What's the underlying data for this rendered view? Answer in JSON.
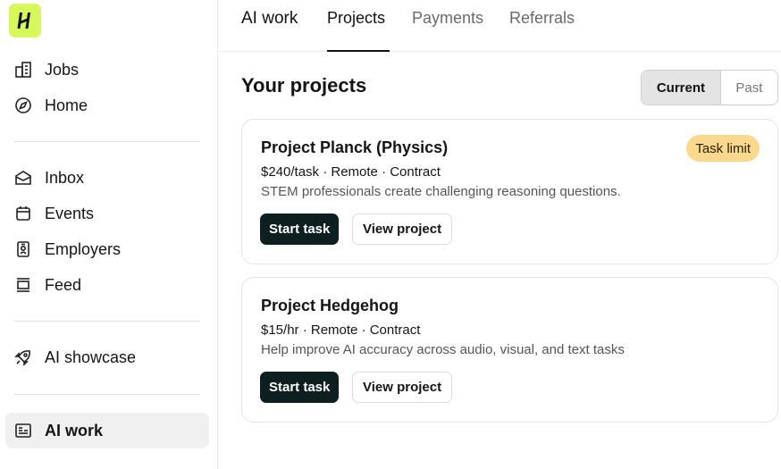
{
  "sidebar": {
    "logo_icon": "handshake-h-logo",
    "items": [
      {
        "label": "Jobs",
        "icon": "building-icon"
      },
      {
        "label": "Home",
        "icon": "compass-icon"
      },
      {
        "label": "Inbox",
        "icon": "inbox-icon"
      },
      {
        "label": "Events",
        "icon": "calendar-icon"
      },
      {
        "label": "Employers",
        "icon": "id-badge-icon"
      },
      {
        "label": "Feed",
        "icon": "feed-icon"
      },
      {
        "label": "AI showcase",
        "icon": "rocket-icon"
      },
      {
        "label": "AI work",
        "icon": "ai-work-icon",
        "active": true
      }
    ]
  },
  "tabs": [
    {
      "label": "AI work"
    },
    {
      "label": "Projects",
      "active": true
    },
    {
      "label": "Payments"
    },
    {
      "label": "Referrals"
    }
  ],
  "main": {
    "title": "Your projects",
    "segment": {
      "current": "Current",
      "past": "Past",
      "selected": "Current"
    },
    "projects": [
      {
        "title": "Project Planck (Physics)",
        "meta": "$240/task · Remote · Contract",
        "description": "STEM professionals create challenging reasoning questions.",
        "badge": "Task limit",
        "start_label": "Start task",
        "view_label": "View project"
      },
      {
        "title": "Project Hedgehog",
        "meta": "$15/hr · Remote · Contract",
        "description": "Help improve AI accuracy across audio, visual, and text tasks",
        "start_label": "Start task",
        "view_label": "View project"
      }
    ]
  },
  "colors": {
    "brand_lime": "#d6f85a",
    "primary_button": "#0d1f1f",
    "badge": "#fad98f",
    "active_nav_bg": "#f0f0f0"
  }
}
